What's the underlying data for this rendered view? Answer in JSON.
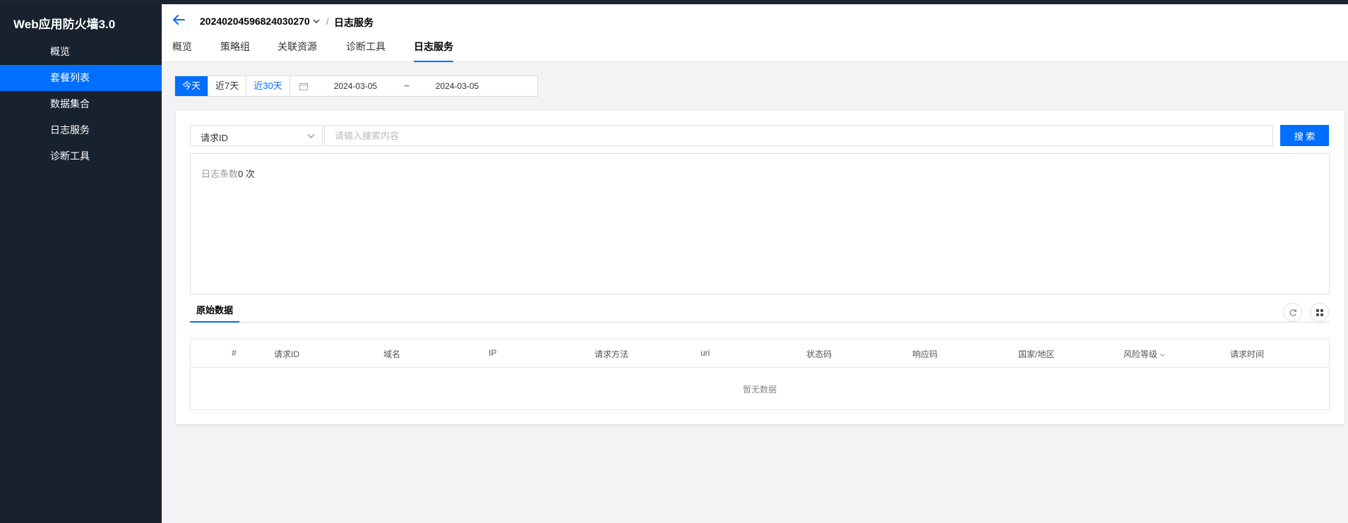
{
  "app": {
    "title": "Web应用防火墙3.0"
  },
  "sidebar": {
    "items": [
      {
        "label": "概览",
        "active": false
      },
      {
        "label": "套餐列表",
        "active": true
      },
      {
        "label": "数据集合",
        "active": false
      },
      {
        "label": "日志服务",
        "active": false
      },
      {
        "label": "诊断工具",
        "active": false
      }
    ]
  },
  "header": {
    "instance_id": "20240204596824030270",
    "breadcrumb_sep": "/",
    "breadcrumb_current": "日志服务"
  },
  "tabs": [
    {
      "label": "概览",
      "active": false
    },
    {
      "label": "策略组",
      "active": false
    },
    {
      "label": "关联资源",
      "active": false
    },
    {
      "label": "诊断工具",
      "active": false
    },
    {
      "label": "日志服务",
      "active": true
    }
  ],
  "date_filter": {
    "quick_options": [
      {
        "label": "今天",
        "state": "active"
      },
      {
        "label": "近7天",
        "state": "normal"
      },
      {
        "label": "近30天",
        "state": "link"
      }
    ],
    "start": "2024-03-05",
    "separator": "~",
    "end": "2024-03-05"
  },
  "search": {
    "field_value": "请求ID",
    "placeholder": "请输入搜索内容",
    "button_label": "搜 索"
  },
  "log_summary": {
    "label": "日志条数",
    "count": "0 次"
  },
  "raw_data": {
    "tab_label": "原始数据",
    "columns": [
      "#",
      "请求ID",
      "域名",
      "IP",
      "请求方法",
      "uri",
      "状态码",
      "响应码",
      "国家/地区",
      "风险等级",
      "请求时间"
    ],
    "empty_text": "暂无数据"
  },
  "colors": {
    "sidebar_bg": "#18212e",
    "accent": "#006eff"
  }
}
